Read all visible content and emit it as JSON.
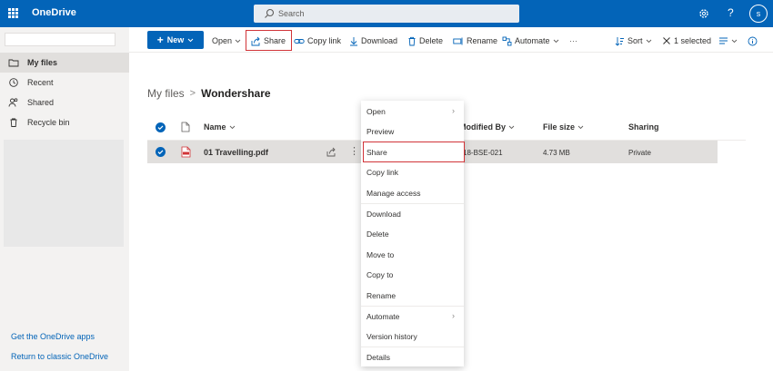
{
  "topbar": {
    "brand": "OneDrive",
    "search_placeholder": "Search",
    "avatar_initial": "s",
    "help_label": "?"
  },
  "sidebar": {
    "items": [
      {
        "label": "My files",
        "icon": "folder-icon"
      },
      {
        "label": "Recent",
        "icon": "clock-icon"
      },
      {
        "label": "Shared",
        "icon": "people-icon"
      },
      {
        "label": "Recycle bin",
        "icon": "recycle-bin-icon"
      }
    ],
    "links": [
      "Get the OneDrive apps",
      "Return to classic OneDrive"
    ]
  },
  "commandbar": {
    "new_label": "New",
    "open_label": "Open",
    "share_label": "Share",
    "copy_link_label": "Copy link",
    "download_label": "Download",
    "delete_label": "Delete",
    "rename_label": "Rename",
    "automate_label": "Automate",
    "more_label": "···",
    "sort_label": "Sort",
    "selected_label": "1 selected"
  },
  "breadcrumb": {
    "root": "My files",
    "separator": ">",
    "current": "Wondershare"
  },
  "table": {
    "columns": [
      "Name",
      "Modified By",
      "File size",
      "Sharing"
    ],
    "rows": [
      {
        "name": "01 Travelling.pdf",
        "modified_by": "18-BSE-021",
        "file_size": "4.73 MB",
        "sharing": "Private"
      }
    ]
  },
  "context_menu": {
    "items": [
      "Open",
      "Preview",
      "Share",
      "Copy link",
      "Manage access",
      "Download",
      "Delete",
      "Move to",
      "Copy to",
      "Rename",
      "Automate",
      "Version history",
      "Details"
    ]
  },
  "colors": {
    "brand_blue": "#0364b8",
    "highlight_red": "#d13438"
  }
}
